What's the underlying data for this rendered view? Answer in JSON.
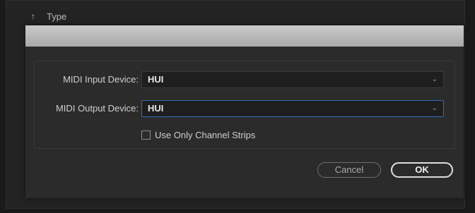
{
  "background": {
    "header_label": "Type",
    "header_icon": "arrow-up-icon"
  },
  "dialog": {
    "midi_input_label": "MIDI Input Device:",
    "midi_input_value": "HUI",
    "midi_output_label": "MIDI Output Device:",
    "midi_output_value": "HUI",
    "checkbox_label": "Use Only Channel Strips",
    "checkbox_checked": false,
    "cancel_label": "Cancel",
    "ok_label": "OK",
    "chevron_glyph": "⌄",
    "colors": {
      "focus_border": "#2f6fb5",
      "dialog_bg": "#2b2b2b",
      "titlebar": "#b9b9b9"
    }
  }
}
